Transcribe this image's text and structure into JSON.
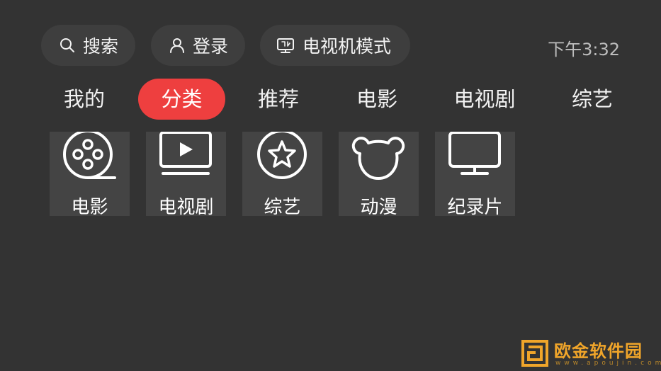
{
  "header": {
    "search_label": "搜索",
    "login_label": "登录",
    "tv_mode_label": "电视机模式",
    "time": "下午3:32"
  },
  "tabs": [
    {
      "label": "我的",
      "active": false
    },
    {
      "label": "分类",
      "active": true
    },
    {
      "label": "推荐",
      "active": false
    },
    {
      "label": "电影",
      "active": false
    },
    {
      "label": "电视剧",
      "active": false
    },
    {
      "label": "综艺",
      "active": false
    }
  ],
  "categories": [
    {
      "label": "电影",
      "icon": "film-reel-icon"
    },
    {
      "label": "电视剧",
      "icon": "play-screen-icon"
    },
    {
      "label": "综艺",
      "icon": "star-circle-icon"
    },
    {
      "label": "动漫",
      "icon": "bear-head-icon"
    },
    {
      "label": "纪录片",
      "icon": "monitor-icon"
    }
  ],
  "watermark": {
    "title": "欧金软件园",
    "url": "www.apoujin.com"
  },
  "colors": {
    "background": "#333333",
    "pill": "#3e3e3e",
    "tile": "#444444",
    "accent": "#ee3f3f",
    "watermark": "#f0a52a"
  }
}
